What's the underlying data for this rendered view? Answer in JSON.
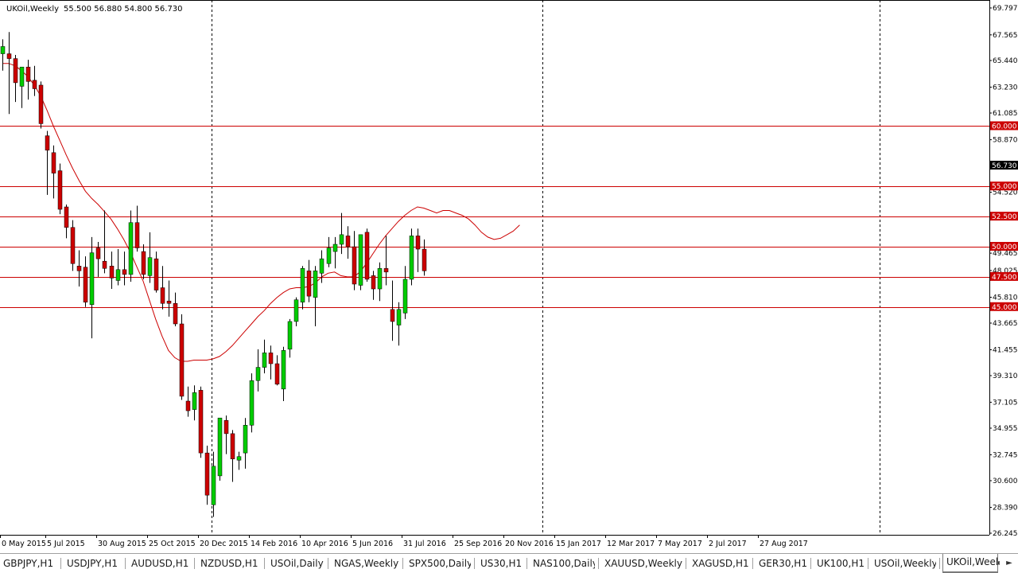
{
  "header": {
    "symbol": "UKOil,Weekly",
    "ohlc": "55.500 56.880 54.800 56.730"
  },
  "colors": {
    "bull": "#00cc00",
    "bear": "#cc0000",
    "ma": "#cc0000",
    "level": "#cc0000",
    "price_tag": "#000000"
  },
  "chart_data": {
    "type": "candlestick",
    "timeframe": "Weekly",
    "ylim": [
      26.245,
      69.797
    ],
    "y_ticks": [
      "69.797",
      "67.565",
      "65.440",
      "63.230",
      "61.085",
      "58.870",
      "54.520",
      "52.505",
      "49.465",
      "48.025",
      "45.810",
      "43.665",
      "41.455",
      "39.310",
      "37.105",
      "34.955",
      "32.745",
      "30.600",
      "28.390",
      "26.245"
    ],
    "x_labels": [
      "0 May 2015",
      "5 Jul 2015",
      "30 Aug 2015",
      "25 Oct 2015",
      "20 Dec 2015",
      "14 Feb 2016",
      "10 Apr 2016",
      "5 Jun 2016",
      "31 Jul 2016",
      "25 Sep 2016",
      "20 Nov 2016",
      "15 Jan 2017",
      "12 Mar 2017",
      "7 May 2017",
      "2 Jul 2017",
      "27 Aug 2017"
    ],
    "horizontal_levels": [
      "60.000",
      "55.000",
      "52.500",
      "50.000",
      "47.500",
      "45.000"
    ],
    "last_price": "56.730",
    "moving_average": [
      65.2,
      65.2,
      65.0,
      64.6,
      64.1,
      63.4,
      62.5,
      61.3,
      60.0,
      58.8,
      57.6,
      56.5,
      55.5,
      54.6,
      54.0,
      53.5,
      52.9,
      52.3,
      51.5,
      50.6,
      49.6,
      48.4,
      47.2,
      45.6,
      44.0,
      42.6,
      41.4,
      40.8,
      40.5,
      40.5,
      40.6,
      40.6,
      40.6,
      40.7,
      40.9,
      41.3,
      41.8,
      42.4,
      43.0,
      43.6,
      44.2,
      44.7,
      45.3,
      45.8,
      46.2,
      46.5,
      46.6,
      46.6,
      46.7,
      47.0,
      47.5,
      47.8,
      47.9,
      47.6,
      47.5,
      47.5,
      47.9,
      48.6,
      49.4,
      50.2,
      50.9,
      51.5,
      52.1,
      52.6,
      53.0,
      53.3,
      53.2,
      53.0,
      52.8,
      53.0,
      53.0,
      52.8,
      52.6,
      52.3,
      51.8,
      51.2,
      50.8,
      50.6,
      50.7,
      51.0,
      51.3,
      51.8
    ],
    "candles": [
      {
        "o": 66.0,
        "h": 67.2,
        "l": 64.6,
        "c": 66.6
      },
      {
        "o": 66.0,
        "h": 67.8,
        "l": 61.0,
        "c": 65.6
      },
      {
        "o": 65.6,
        "h": 65.9,
        "l": 62.0,
        "c": 63.6
      },
      {
        "o": 63.3,
        "h": 64.9,
        "l": 61.5,
        "c": 64.9
      },
      {
        "o": 64.9,
        "h": 65.5,
        "l": 62.2,
        "c": 63.7
      },
      {
        "o": 63.8,
        "h": 65.0,
        "l": 62.5,
        "c": 63.1
      },
      {
        "o": 63.4,
        "h": 63.7,
        "l": 59.8,
        "c": 60.2
      },
      {
        "o": 59.2,
        "h": 59.6,
        "l": 54.3,
        "c": 58.0
      },
      {
        "o": 57.8,
        "h": 58.4,
        "l": 54.0,
        "c": 56.1
      },
      {
        "o": 56.3,
        "h": 56.9,
        "l": 52.7,
        "c": 53.1
      },
      {
        "o": 53.3,
        "h": 53.5,
        "l": 50.7,
        "c": 51.6
      },
      {
        "o": 51.6,
        "h": 52.2,
        "l": 48.0,
        "c": 48.6
      },
      {
        "o": 48.4,
        "h": 49.7,
        "l": 46.7,
        "c": 48.0
      },
      {
        "o": 48.3,
        "h": 49.2,
        "l": 45.0,
        "c": 45.4
      },
      {
        "o": 45.2,
        "h": 50.8,
        "l": 42.4,
        "c": 49.5
      },
      {
        "o": 49.9,
        "h": 50.4,
        "l": 47.5,
        "c": 49.0
      },
      {
        "o": 48.8,
        "h": 53.0,
        "l": 47.8,
        "c": 48.2
      },
      {
        "o": 48.4,
        "h": 49.6,
        "l": 46.5,
        "c": 47.4
      },
      {
        "o": 47.2,
        "h": 49.8,
        "l": 46.8,
        "c": 48.1
      },
      {
        "o": 48.1,
        "h": 49.6,
        "l": 46.8,
        "c": 47.7
      },
      {
        "o": 47.7,
        "h": 53.0,
        "l": 47.1,
        "c": 52.0
      },
      {
        "o": 52.0,
        "h": 53.4,
        "l": 49.6,
        "c": 49.9
      },
      {
        "o": 49.6,
        "h": 50.2,
        "l": 47.3,
        "c": 47.7
      },
      {
        "o": 47.6,
        "h": 51.2,
        "l": 47.0,
        "c": 49.1
      },
      {
        "o": 49.0,
        "h": 49.6,
        "l": 46.2,
        "c": 46.4
      },
      {
        "o": 46.6,
        "h": 48.4,
        "l": 44.8,
        "c": 45.3
      },
      {
        "o": 45.5,
        "h": 47.2,
        "l": 44.2,
        "c": 45.3
      },
      {
        "o": 45.3,
        "h": 46.2,
        "l": 43.4,
        "c": 43.6
      },
      {
        "o": 43.6,
        "h": 44.4,
        "l": 37.3,
        "c": 37.6
      },
      {
        "o": 37.2,
        "h": 38.4,
        "l": 35.9,
        "c": 36.4
      },
      {
        "o": 36.5,
        "h": 38.5,
        "l": 35.6,
        "c": 37.9
      },
      {
        "o": 38.1,
        "h": 38.4,
        "l": 32.5,
        "c": 32.9
      },
      {
        "o": 32.9,
        "h": 33.5,
        "l": 28.6,
        "c": 29.4
      },
      {
        "o": 28.6,
        "h": 33.0,
        "l": 27.6,
        "c": 31.8
      },
      {
        "o": 31.0,
        "h": 35.8,
        "l": 30.6,
        "c": 35.8
      },
      {
        "o": 35.6,
        "h": 36.0,
        "l": 32.8,
        "c": 34.5
      },
      {
        "o": 34.5,
        "h": 34.8,
        "l": 30.5,
        "c": 32.4
      },
      {
        "o": 32.3,
        "h": 33.0,
        "l": 31.5,
        "c": 32.6
      },
      {
        "o": 32.9,
        "h": 35.8,
        "l": 31.6,
        "c": 35.2
      },
      {
        "o": 35.2,
        "h": 39.5,
        "l": 34.6,
        "c": 38.9
      },
      {
        "o": 38.9,
        "h": 41.5,
        "l": 38.0,
        "c": 40.0
      },
      {
        "o": 40.0,
        "h": 42.3,
        "l": 39.5,
        "c": 41.2
      },
      {
        "o": 41.2,
        "h": 41.8,
        "l": 39.0,
        "c": 40.3
      },
      {
        "o": 40.3,
        "h": 41.0,
        "l": 38.5,
        "c": 38.6
      },
      {
        "o": 38.2,
        "h": 41.7,
        "l": 37.2,
        "c": 41.4
      },
      {
        "o": 41.5,
        "h": 44.0,
        "l": 40.8,
        "c": 43.8
      },
      {
        "o": 43.8,
        "h": 45.8,
        "l": 43.4,
        "c": 45.6
      },
      {
        "o": 45.4,
        "h": 48.4,
        "l": 44.8,
        "c": 48.2
      },
      {
        "o": 48.0,
        "h": 48.9,
        "l": 45.4,
        "c": 45.9
      },
      {
        "o": 45.8,
        "h": 48.4,
        "l": 43.4,
        "c": 48.0
      },
      {
        "o": 47.8,
        "h": 49.7,
        "l": 47.0,
        "c": 49.0
      },
      {
        "o": 48.6,
        "h": 50.8,
        "l": 48.3,
        "c": 49.9
      },
      {
        "o": 49.6,
        "h": 50.8,
        "l": 48.2,
        "c": 50.2
      },
      {
        "o": 50.2,
        "h": 52.8,
        "l": 49.4,
        "c": 51.0
      },
      {
        "o": 50.9,
        "h": 51.7,
        "l": 49.0,
        "c": 50.0
      },
      {
        "o": 50.0,
        "h": 51.3,
        "l": 46.4,
        "c": 46.9
      },
      {
        "o": 46.8,
        "h": 51.0,
        "l": 46.4,
        "c": 51.0
      },
      {
        "o": 51.2,
        "h": 51.5,
        "l": 47.1,
        "c": 47.3
      },
      {
        "o": 47.6,
        "h": 48.0,
        "l": 45.6,
        "c": 46.5
      },
      {
        "o": 46.5,
        "h": 48.7,
        "l": 45.5,
        "c": 48.2
      },
      {
        "o": 48.2,
        "h": 50.9,
        "l": 46.8,
        "c": 47.9
      },
      {
        "o": 44.8,
        "h": 47.2,
        "l": 42.2,
        "c": 43.8
      },
      {
        "o": 43.5,
        "h": 45.4,
        "l": 41.8,
        "c": 44.8
      },
      {
        "o": 44.5,
        "h": 48.4,
        "l": 44.0,
        "c": 47.3
      },
      {
        "o": 47.3,
        "h": 51.5,
        "l": 46.8,
        "c": 50.9
      },
      {
        "o": 50.9,
        "h": 51.5,
        "l": 47.9,
        "c": 49.8
      },
      {
        "o": 49.8,
        "h": 50.6,
        "l": 47.6,
        "c": 48.0
      }
    ]
  },
  "tabs": [
    "GBPJPY,H1",
    "USDJPY,H1",
    "AUDUSD,H1",
    "NZDUSD,H1",
    "USOil,Daily",
    "NGAS,Weekly",
    "SPX500,Daily",
    "US30,H1",
    "NAS100,Daily",
    "XAUUSD,Weekly",
    "XAGUSD,H1",
    "GER30,H1",
    "UK100,H1",
    "USOil,Weekly",
    "UKOil,Weekly"
  ],
  "active_tab": "UKOil,Weekly"
}
